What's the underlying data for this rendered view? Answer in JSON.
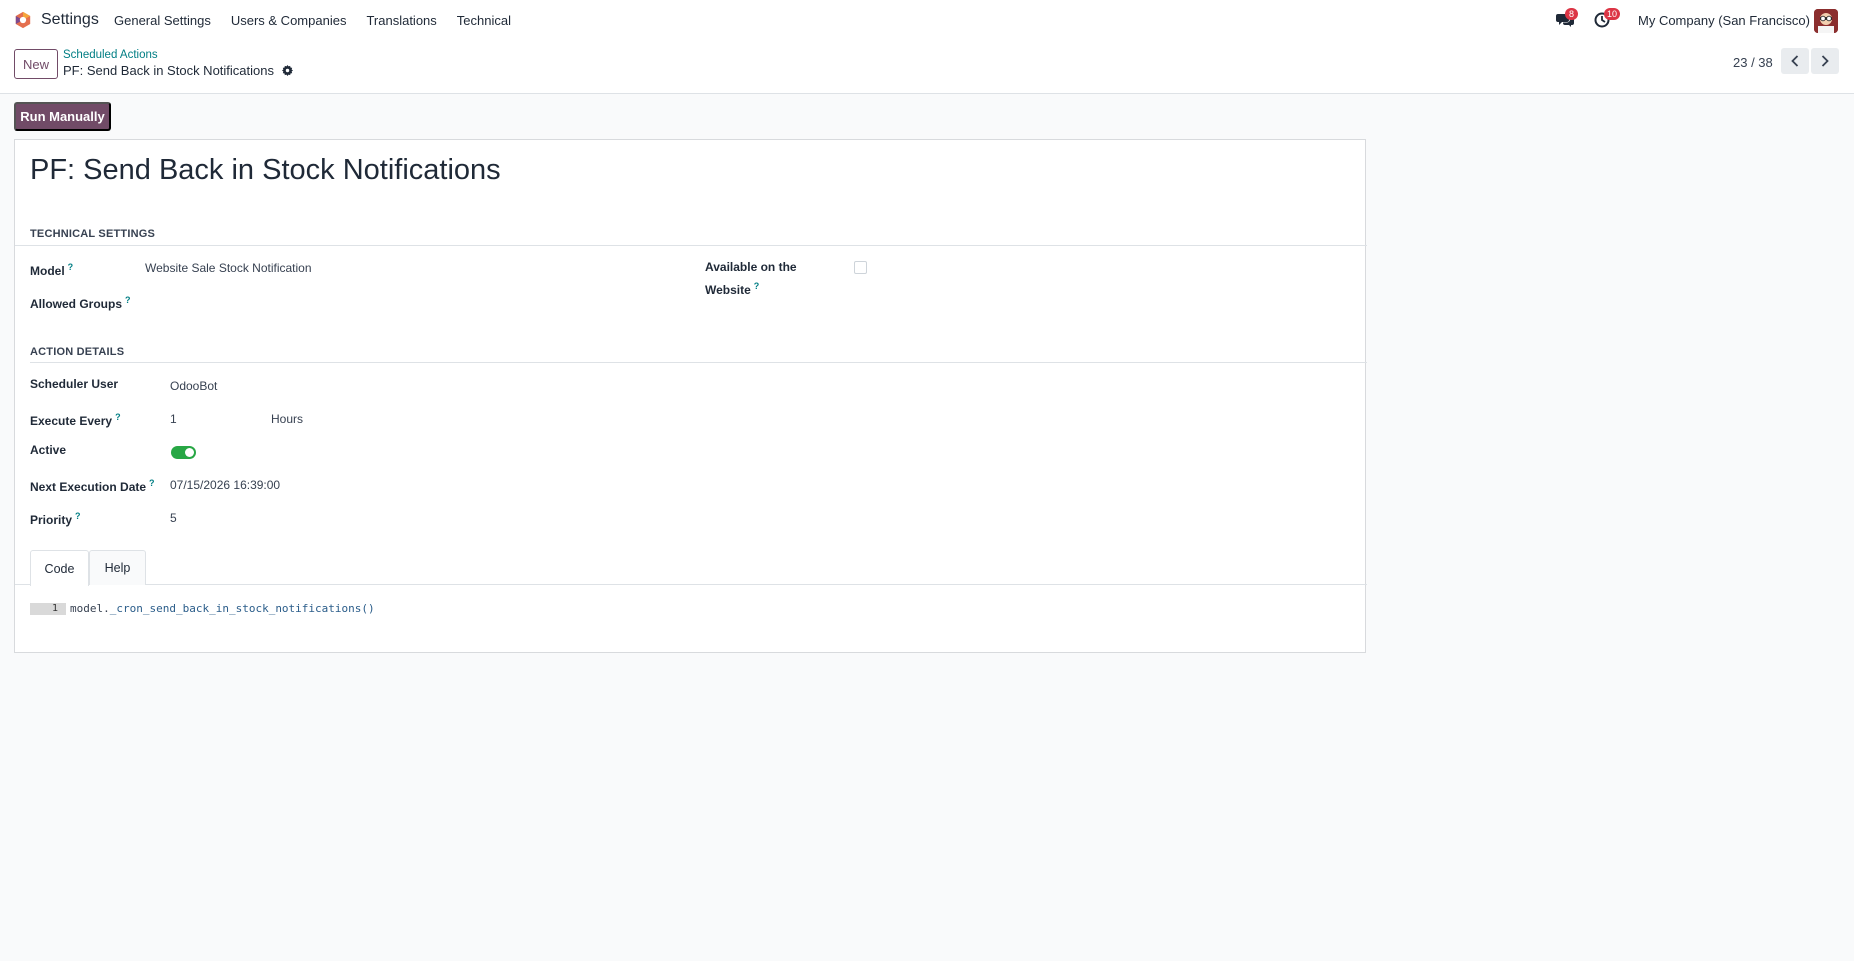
{
  "navbar": {
    "app_name": "Settings",
    "menu": [
      "General Settings",
      "Users & Companies",
      "Translations",
      "Technical"
    ],
    "messages_count": "8",
    "activities_count": "10",
    "company": "My Company (San Francisco)"
  },
  "control_panel": {
    "new_label": "New",
    "breadcrumb_parent": "Scheduled Actions",
    "breadcrumb_current": "PF: Send Back in Stock Notifications",
    "pager": "23 / 38"
  },
  "actions": {
    "run_manually": "Run Manually"
  },
  "form": {
    "title": "PF: Send Back in Stock Notifications",
    "technical_settings": {
      "heading": "TECHNICAL SETTINGS",
      "model_label": "Model",
      "model_value": "Website Sale Stock Notification",
      "allowed_groups_label": "Allowed Groups",
      "website_label_line1": "Available on the",
      "website_label_line2": "Website"
    },
    "action_details": {
      "heading": "ACTION DETAILS",
      "scheduler_user_label": "Scheduler User",
      "scheduler_user_value": "OdooBot",
      "execute_every_label": "Execute Every",
      "execute_every_value": "1",
      "execute_every_unit": "Hours",
      "active_label": "Active",
      "next_execution_label": "Next Execution Date",
      "next_execution_value": "07/15/2026 16:39:00",
      "priority_label": "Priority",
      "priority_value": "5"
    },
    "tabs": [
      "Code",
      "Help"
    ],
    "code": {
      "line_number": "1",
      "prefix": "model.",
      "call": "_cron_send_back_in_stock_notifications()"
    }
  },
  "colors": {
    "brand": "#714b67",
    "link": "#017e84",
    "toggle_on": "#28a745",
    "badge": "#dc3545"
  }
}
